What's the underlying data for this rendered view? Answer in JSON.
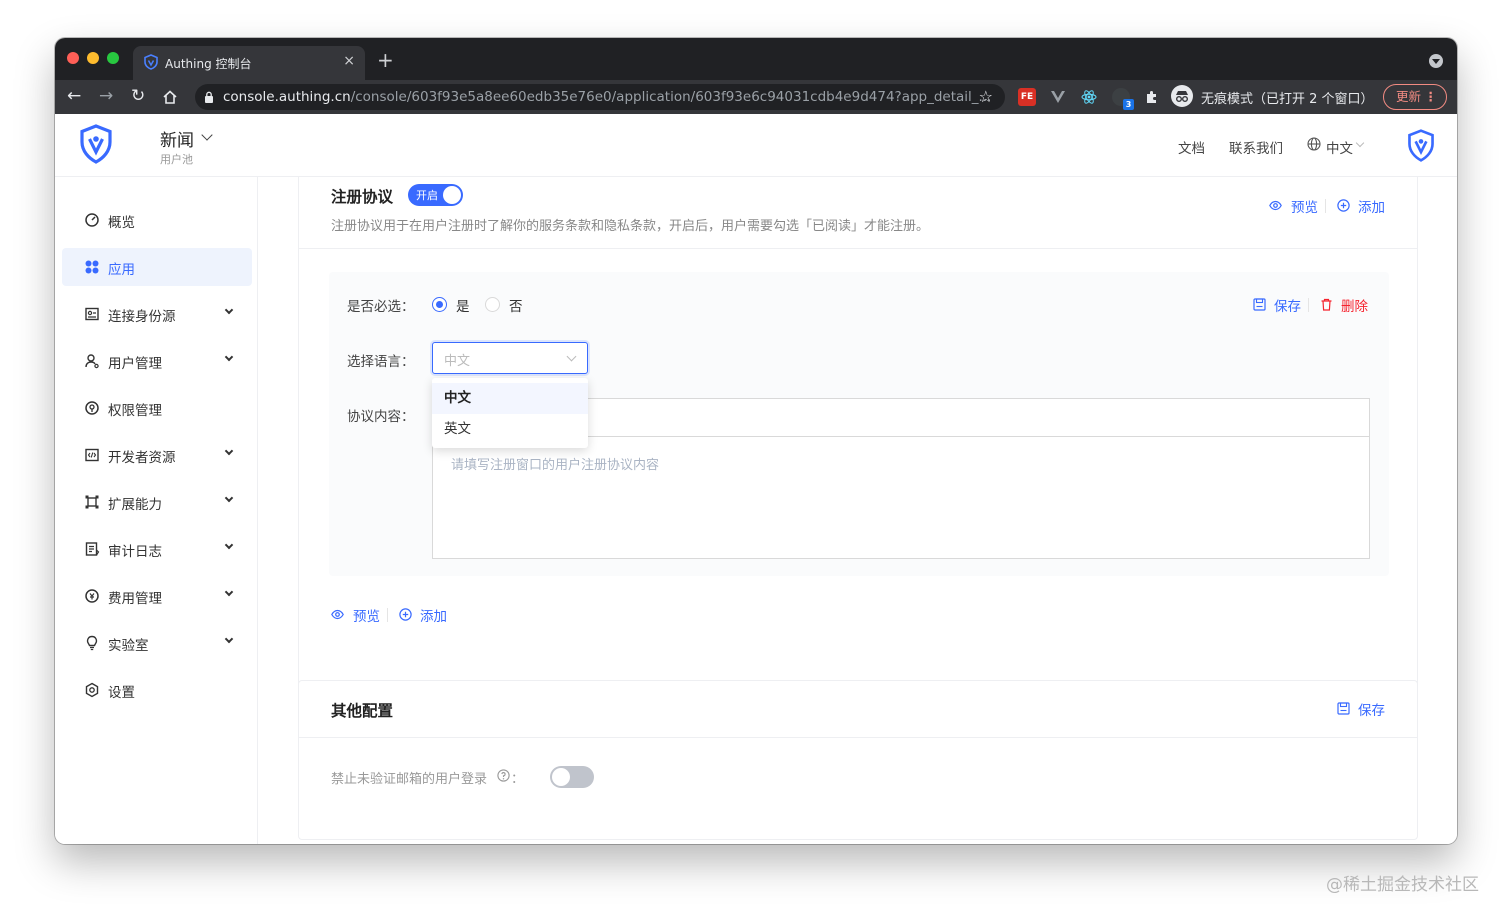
{
  "browser": {
    "tab_title": "Authing 控制台",
    "tab_close": "×",
    "new_tab": "+",
    "url_host": "console.authing.cn",
    "url_path": "/console/603f93e5a8ee60edb35e76e0/application/603f93e6c94031cdb4e9d474?app_detail_...",
    "incognito_label": "无痕模式（已打开 2 个窗口）",
    "update_label": "更新",
    "ext_fe": "FE",
    "ext_badge": "3"
  },
  "header": {
    "pool_name": "新闻",
    "pool_sub": "用户池",
    "docs": "文档",
    "contact": "联系我们",
    "lang": "中文"
  },
  "sidebar": {
    "items": [
      {
        "label": "概览",
        "icon": "dashboard-icon",
        "chevron": false,
        "active": false
      },
      {
        "label": "应用",
        "icon": "apps-icon",
        "chevron": false,
        "active": true
      },
      {
        "label": "连接身份源",
        "icon": "identity-icon",
        "chevron": true,
        "active": false
      },
      {
        "label": "用户管理",
        "icon": "user-icon",
        "chevron": true,
        "active": false
      },
      {
        "label": "权限管理",
        "icon": "permission-icon",
        "chevron": false,
        "active": false
      },
      {
        "label": "开发者资源",
        "icon": "code-icon",
        "chevron": true,
        "active": false
      },
      {
        "label": "扩展能力",
        "icon": "extension-icon",
        "chevron": true,
        "active": false
      },
      {
        "label": "审计日志",
        "icon": "log-icon",
        "chevron": true,
        "active": false
      },
      {
        "label": "费用管理",
        "icon": "billing-icon",
        "chevron": true,
        "active": false
      },
      {
        "label": "实验室",
        "icon": "lab-icon",
        "chevron": true,
        "active": false
      },
      {
        "label": "设置",
        "icon": "settings-icon",
        "chevron": false,
        "active": false
      }
    ]
  },
  "agreement": {
    "title": "注册协议",
    "toggle_label": "开启",
    "description": "注册协议用于在用户注册时了解你的服务条款和隐私条款，开启后，用户需要勾选「已阅读」才能注册。",
    "preview": "预览",
    "add": "添加",
    "required_label": "是否必选：",
    "yes": "是",
    "no": "否",
    "save": "保存",
    "delete": "删除",
    "lang_label": "选择语言：",
    "lang_value": "中文",
    "content_label": "协议内容：",
    "content_placeholder": "请填写注册窗口的用户注册协议内容",
    "dropdown_options": [
      "中文",
      "英文"
    ],
    "bottom_preview": "预览",
    "bottom_add": "添加"
  },
  "other": {
    "title": "其他配置",
    "save": "保存",
    "option_label": "禁止未验证邮箱的用户登录",
    "option_colon": "："
  },
  "watermark": "@稀土掘金技术社区",
  "colors": {
    "primary": "#396aff",
    "danger": "#f5222d",
    "active_bg": "#eef3fd"
  }
}
